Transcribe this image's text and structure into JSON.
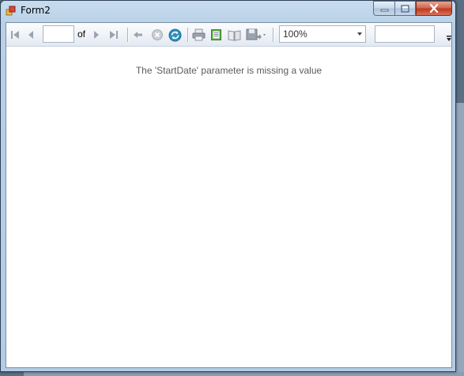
{
  "window": {
    "title": "Form2"
  },
  "toolbar": {
    "first_page_icon": "first-page-icon",
    "prev_page_icon": "previous-page-icon",
    "current_page_value": "",
    "of_label": "of",
    "next_page_icon": "next-page-icon",
    "last_page_icon": "last-page-icon",
    "back_icon": "back-to-parent-icon",
    "stop_icon": "stop-rendering-icon",
    "refresh_icon": "refresh-icon",
    "print_icon": "print-icon",
    "print_layout_icon": "print-layout-icon",
    "page_setup_icon": "page-setup-icon",
    "export_icon": "export-icon",
    "zoom_value": "100%",
    "find_value": ""
  },
  "report": {
    "message": "The 'StartDate' parameter is missing a value"
  },
  "colors": {
    "window_frame": "#b9d1e8",
    "close_button": "#c0391f",
    "message_text": "#5b5b5b"
  }
}
